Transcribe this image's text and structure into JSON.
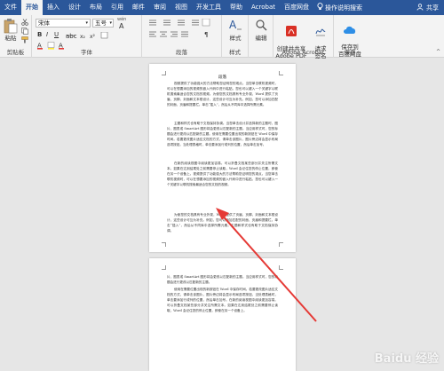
{
  "tabs": [
    {
      "label": "文件"
    },
    {
      "label": "开始"
    },
    {
      "label": "插入"
    },
    {
      "label": "设计"
    },
    {
      "label": "布局"
    },
    {
      "label": "引用"
    },
    {
      "label": "邮件"
    },
    {
      "label": "审阅"
    },
    {
      "label": "视图"
    },
    {
      "label": "开发工具"
    },
    {
      "label": "帮助"
    },
    {
      "label": "Acrobat"
    },
    {
      "label": "百度网盘"
    }
  ],
  "tell_me": "操作说明搜索",
  "share": "共享",
  "ribbon": {
    "clipboard": {
      "paste": "粘贴",
      "label": "剪贴板"
    },
    "font": {
      "font_name": "宋体",
      "font_size": "五号",
      "wen": "wén",
      "A": "A",
      "bold": "B",
      "italic": "I",
      "underline": "U",
      "label": "字体"
    },
    "paragraph": {
      "label": "段落"
    },
    "styles": {
      "button": "样式",
      "label": "样式"
    },
    "editing": {
      "button": "编辑"
    },
    "acrobat": {
      "create_share": "创建并共享\nAdobe PDF",
      "request_sign": "请求\n签名",
      "label": "Adobe Acrobat"
    },
    "save": {
      "button": "保存到\n百度网盘",
      "label": "保存"
    }
  },
  "document": {
    "page1": {
      "title": "段落",
      "paragraphs": [
        {
          "pre": "视频提供了功能强大的方法帮助您证明您的观点。当您单击联机视频时，可以在想要添加的视频的嵌入代码中进行粘贴。您也可以键入一个关键字以联机搜索最适合您的文档的视频。为使您的文档具有专业外观，Word 提供了页眉、页脚、封面和文本框设计，这些设计可互为补充。例如，您可以添加匹配的封面、页眉和提要栏。单击“插入”，然后从不同库中选择所需元素。",
          "link": "",
          "post": ""
        },
        {
          "pre": "主题和样式也有助于文档保持协调。当您单击设计并选择新的主题时，图片、图表或 SmartArt 图形将会更改以匹配新的主题。当应用样式时，您的标题会进行更改以匹配新的主题。使用在需要位置出现的新按钮在 Word 中保存时间。若要更改图片适应文档的方式，请单击该图片，图片旁边将会显示布局选项按钮。当处理表格时，单击要添加行或列的位置，然后单击加号。",
          "link": "",
          "post": ""
        },
        {
          "pre": "在新的阅读视图中阅读更加容易。可以折叠文档某些部分并关注所需文本。如果在达到结尾处之前需要停止读取，Word 会记住您的停止位置，即使在另一个设备上。视频提供了功能强大的方法帮助您证明您的观点。当您单击联机视频时，可以在想要添加的视频的嵌入代码中进行粘贴。您也可以键入一个关键字以联机搜索最适合您的文档的视频。",
          "link": "",
          "post": ""
        },
        {
          "pre": "为使您的文档具有专业外观，Word 提供了页眉、页脚、封面和文本框设计，这些设计可互为补充。例如，您可以添加匹配的封面、页眉和提要栏。单击“插入”，然后从不同库中选择所需元素。主题和样式也有助于文档保持协调。",
          "link": "",
          "post": ""
        }
      ]
    },
    "page2": {
      "paragraphs": [
        {
          "pre": "片、图表或 SmartArt 图形将会更改以匹配新的主题。当应用样式时，您的标题会进行更改以匹配新的主题。",
          "link": "",
          "post": ""
        },
        {
          "pre": "使用在需要位置出现的新按钮在 Word 中保存时间。若要更改图片适应文档的方式，请单击该图片，图片旁边将会显示布局选项按钮。当处理表格时，单击要添加行或列的位置，然后单击加号。在新的阅读视图中阅读更加容易。可以折叠文档某些部分并关注所需文本。如果在达到结尾处之前需要停止读取，Word 会记住您的停止位置，即使在另一个设备上。",
          "link": "",
          "post": ""
        }
      ]
    }
  },
  "watermark": "Baidu 经验",
  "colors": {
    "accent": "#2b579a",
    "arrow": "#e53935"
  }
}
